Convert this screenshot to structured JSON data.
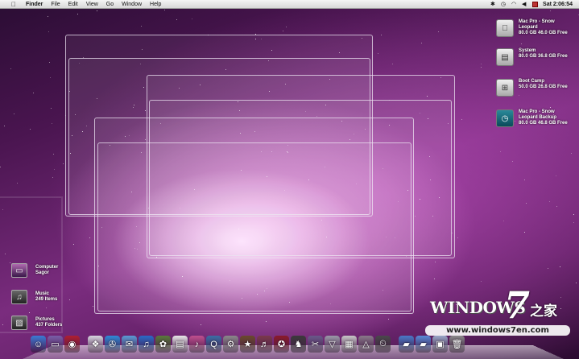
{
  "menubar": {
    "apple_icon": "apple-logo",
    "items": [
      "Finder",
      "File",
      "Edit",
      "View",
      "Go",
      "Window",
      "Help"
    ],
    "clock": "Sat 2:06:54"
  },
  "drives": [
    {
      "name": "Mac Pro - Snow Leopard",
      "line1": "Mac Pro - Snow",
      "line2": "Leopard",
      "line3": "80.0 GB 46.0 GB Free",
      "icon": "hard-drive-icon"
    },
    {
      "name": "System",
      "line1": "System",
      "line2": "80.0 GB 36.8 GB Free",
      "line3": "",
      "icon": "hard-drive-icon"
    },
    {
      "name": "Boot Camp",
      "line1": "Boot Camp",
      "line2": "50.0 GB 26.8 GB Free",
      "line3": "",
      "icon": "windows-drive-icon"
    },
    {
      "name": "Mac Pro - Snow Leopard Backup",
      "line1": "Mac Pro - Snow",
      "line2": "Leopard Backup",
      "line3": "80.0 GB 46.8 GB Free",
      "icon": "time-machine-icon"
    }
  ],
  "stacks": [
    {
      "title": "Computer",
      "subtitle": "Sagor",
      "icon": "computer-icon"
    },
    {
      "title": "Music",
      "subtitle": "249 Items",
      "icon": "music-icon"
    },
    {
      "title": "Pictures",
      "subtitle": "437 Folders",
      "icon": "pictures-icon"
    }
  ],
  "watermark": {
    "brand": "WINDOWS",
    "seven": "7",
    "cn": "之家",
    "url": "www.windows7en.com"
  },
  "dock_apps": [
    {
      "name": "finder",
      "glyph": "☺",
      "color": "#3a7bd5"
    },
    {
      "name": "display",
      "glyph": "▭",
      "color": "#7a5fa8"
    },
    {
      "name": "front-row",
      "glyph": "◉",
      "color": "#b02030"
    },
    {
      "name": "spacer",
      "glyph": "",
      "color": "transparent"
    },
    {
      "name": "preview",
      "glyph": "❖",
      "color": "#d8d8e0"
    },
    {
      "name": "safari",
      "glyph": "✇",
      "color": "#2e8ad8"
    },
    {
      "name": "ichat",
      "glyph": "✉",
      "color": "#5b9bd5"
    },
    {
      "name": "itunes",
      "glyph": "♫",
      "color": "#2a6bc8"
    },
    {
      "name": "iphoto",
      "glyph": "✿",
      "color": "#5a7a3a"
    },
    {
      "name": "calendar",
      "glyph": "▤",
      "color": "#e8e8e8"
    },
    {
      "name": "itunes-2",
      "glyph": "♪",
      "color": "#c0508e"
    },
    {
      "name": "quicktime",
      "glyph": "Q",
      "color": "#3a6ea5"
    },
    {
      "name": "system-prefs",
      "glyph": "⚙",
      "color": "#8a8a8a"
    },
    {
      "name": "imovie",
      "glyph": "★",
      "color": "#6a4a2a"
    },
    {
      "name": "garageband",
      "glyph": "♬",
      "color": "#7a3a4a"
    },
    {
      "name": "photo-booth",
      "glyph": "✪",
      "color": "#8a1a2a"
    },
    {
      "name": "chess",
      "glyph": "♞",
      "color": "#3a3a3a"
    },
    {
      "name": "utilities",
      "glyph": "✂",
      "color": "#6a5a8a"
    },
    {
      "name": "applications",
      "glyph": "▽",
      "color": "#9a9aa8"
    },
    {
      "name": "documents",
      "glyph": "▦",
      "color": "#c8c8c8"
    },
    {
      "name": "triangle",
      "glyph": "△",
      "color": "#8a7a8a"
    },
    {
      "name": "time-machine",
      "glyph": "⏲",
      "color": "#4a4a4a"
    },
    {
      "name": "spacer-2",
      "glyph": "",
      "color": "transparent"
    },
    {
      "name": "folder-blue",
      "glyph": "▰",
      "color": "#4a7ac8"
    },
    {
      "name": "folder-downloads",
      "glyph": "▰",
      "color": "#5a8ad8"
    },
    {
      "name": "folder-docs",
      "glyph": "▣",
      "color": "#9aa8c8"
    },
    {
      "name": "trash",
      "glyph": "🗑",
      "color": "#8a8a8a"
    }
  ]
}
